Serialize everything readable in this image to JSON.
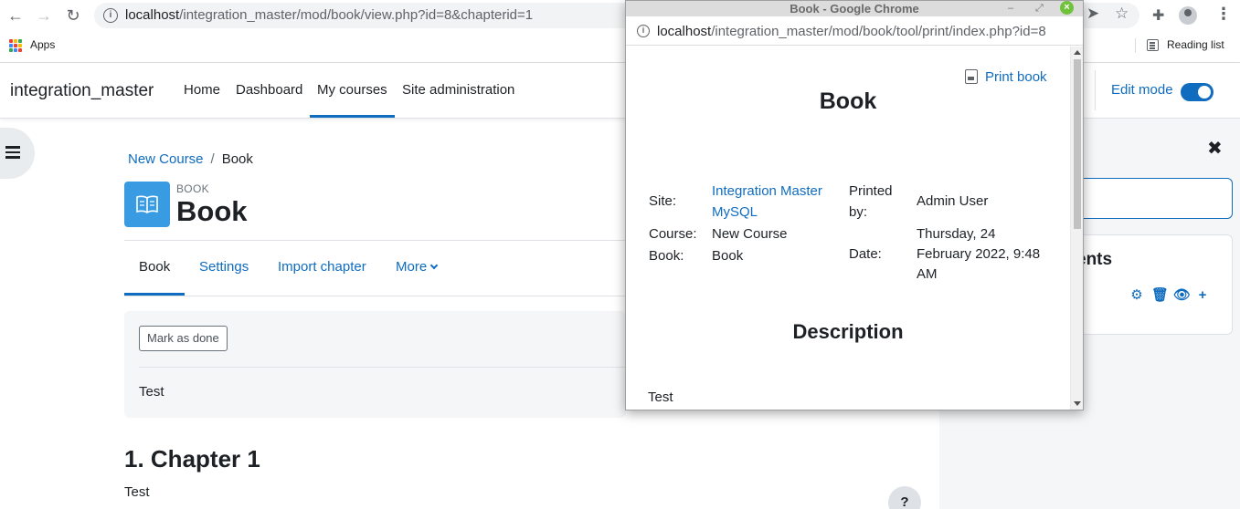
{
  "browser": {
    "url_host": "localhost",
    "url_path": "/integration_master/mod/book/view.php?id=8&chapterid=1",
    "bookmarks_apps_label": "Apps",
    "reading_list_label": "Reading list",
    "apps_colors": [
      "#ea4335",
      "#fbbc04",
      "#34a853",
      "#4285f4",
      "#ea4335",
      "#fbbc04",
      "#34a853",
      "#4285f4",
      "#ea4335"
    ]
  },
  "navbar": {
    "brand": "integration_master",
    "items": [
      "Home",
      "Dashboard",
      "My courses",
      "Site administration"
    ],
    "edit_mode_label": "Edit mode"
  },
  "breadcrumb": {
    "course": "New Course",
    "separator": "/",
    "current": "Book"
  },
  "activity": {
    "type_label": "BOOK",
    "title": "Book"
  },
  "secondary_nav": {
    "book": "Book",
    "settings": "Settings",
    "import_chapter": "Import chapter",
    "more": "More"
  },
  "completion": {
    "mark_done_label": "Mark as done",
    "intro_text": "Test"
  },
  "chapter": {
    "title": "1. Chapter 1",
    "text": "Test"
  },
  "help_button": "?",
  "right_drawer": {
    "close_glyph": "✖",
    "card_title_partial": "ents"
  },
  "popup": {
    "window_title": "Book - Google Chrome",
    "url_host": "localhost",
    "url_path": "/integration_master/mod/book/tool/print/index.php?id=8",
    "print_book_label": "Print book",
    "heading": "Book",
    "info": {
      "site_label": "Site:",
      "site_value_line1": "Integration Master",
      "site_value_line2": "MySQL",
      "course_label": "Course:",
      "course_value": "New Course",
      "book_label": "Book:",
      "book_value": "Book",
      "printed_by_label_line1": "Printed",
      "printed_by_label_line2": "by:",
      "printed_by_value": "Admin User",
      "date_label": "Date:",
      "date_value_line1": "Thursday, 24",
      "date_value_line2": "February 2022, 9:48",
      "date_value_line3": "AM"
    },
    "description_heading": "Description",
    "description_text": "Test"
  },
  "colors": {
    "primary": "#0f6cbf",
    "activity_icon_bg": "#399be2"
  }
}
